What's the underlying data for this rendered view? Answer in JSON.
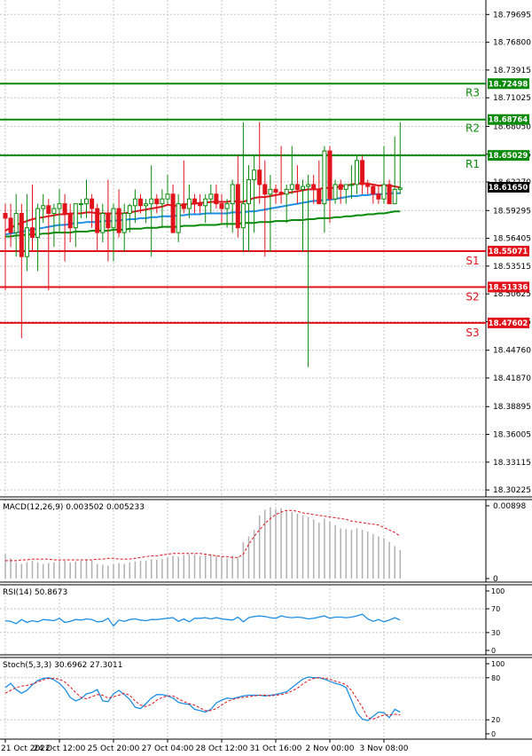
{
  "chart_data": {
    "type": "candlestick",
    "price_pane": {
      "ylim": [
        18.295,
        18.812
      ],
      "y_tick_labels": [
        "18.79695",
        "18.76800",
        "18.73915",
        "18.71025",
        "18.68050",
        "18.65155",
        "18.62270",
        "18.59295",
        "18.56405",
        "18.53515",
        "18.50625",
        "18.47735",
        "18.44760",
        "18.41870",
        "18.38895",
        "18.36005",
        "18.33115",
        "18.30225"
      ],
      "y_ticks": [
        18.79695,
        18.768,
        18.73915,
        18.71025,
        18.6805,
        18.65155,
        18.6227,
        18.59295,
        18.56405,
        18.53515,
        18.50625,
        18.47735,
        18.4476,
        18.4187,
        18.38895,
        18.36005,
        18.33115,
        18.30225
      ],
      "current_price_label": "18.61650",
      "current_price": 18.6165,
      "levels": [
        {
          "name": "R3",
          "value": 18.72498,
          "label": "18.72498",
          "color": "#0a8a0a"
        },
        {
          "name": "R2",
          "value": 18.68764,
          "label": "18.68764",
          "color": "#0a8a0a"
        },
        {
          "name": "R1",
          "value": 18.65029,
          "label": "18.65029",
          "color": "#0a8a0a"
        },
        {
          "name": "S1",
          "value": 18.55071,
          "label": "18.55071",
          "color": "#e0121b"
        },
        {
          "name": "S2",
          "value": 18.51336,
          "label": "18.51336",
          "color": "#e0121b"
        },
        {
          "name": "S3",
          "value": 18.47602,
          "label": "18.47602",
          "color": "#e0121b"
        }
      ],
      "candles": [
        [
          18.59,
          18.6,
          18.51,
          18.585
        ],
        [
          18.585,
          18.6,
          18.555,
          18.57
        ],
        [
          18.57,
          18.61,
          18.545,
          18.59
        ],
        [
          18.59,
          18.6,
          18.46,
          18.545
        ],
        [
          18.545,
          18.61,
          18.53,
          18.575
        ],
        [
          18.575,
          18.62,
          18.55,
          18.565
        ],
        [
          18.565,
          18.6,
          18.53,
          18.595
        ],
        [
          18.595,
          18.61,
          18.58,
          18.598
        ],
        [
          18.598,
          18.605,
          18.51,
          18.59
        ],
        [
          18.59,
          18.6,
          18.555,
          18.595
        ],
        [
          18.595,
          18.615,
          18.57,
          18.6
        ],
        [
          18.6,
          18.61,
          18.54,
          18.59
        ],
        [
          18.59,
          18.6,
          18.56,
          18.575
        ],
        [
          18.575,
          18.6,
          18.555,
          18.6
        ],
        [
          18.6,
          18.605,
          18.585,
          18.6
        ],
        [
          18.6,
          18.625,
          18.585,
          18.605
        ],
        [
          18.605,
          18.61,
          18.575,
          18.595
        ],
        [
          18.595,
          18.6,
          18.55,
          18.57
        ],
        [
          18.57,
          18.6,
          18.56,
          18.59
        ],
        [
          18.59,
          18.625,
          18.54,
          18.575
        ],
        [
          18.575,
          18.6,
          18.54,
          18.595
        ],
        [
          18.595,
          18.615,
          18.565,
          18.57
        ],
        [
          18.57,
          18.6,
          18.55,
          18.59
        ],
        [
          18.59,
          18.6,
          18.57,
          18.598
        ],
        [
          18.598,
          18.615,
          18.58,
          18.605
        ],
        [
          18.605,
          18.61,
          18.59,
          18.598
        ],
        [
          18.598,
          18.605,
          18.58,
          18.6
        ],
        [
          18.6,
          18.64,
          18.545,
          18.605
        ],
        [
          18.605,
          18.61,
          18.59,
          18.6
        ],
        [
          18.6,
          18.615,
          18.575,
          18.605
        ],
        [
          18.605,
          18.63,
          18.6,
          18.61
        ],
        [
          18.61,
          18.62,
          18.58,
          18.57
        ],
        [
          18.57,
          18.61,
          18.56,
          18.6
        ],
        [
          18.6,
          18.645,
          18.59,
          18.595
        ],
        [
          18.595,
          18.62,
          18.585,
          18.605
        ],
        [
          18.605,
          18.61,
          18.59,
          18.6
        ],
        [
          18.6,
          18.61,
          18.59,
          18.598
        ],
        [
          18.598,
          18.61,
          18.58,
          18.605
        ],
        [
          18.605,
          18.62,
          18.59,
          18.61
        ],
        [
          18.61,
          18.62,
          18.595,
          18.6
        ],
        [
          18.6,
          18.61,
          18.58,
          18.595
        ],
        [
          18.595,
          18.605,
          18.575,
          18.6
        ],
        [
          18.6,
          18.625,
          18.57,
          18.62
        ],
        [
          18.62,
          18.65,
          18.565,
          18.575
        ],
        [
          18.575,
          18.685,
          18.55,
          18.6
        ],
        [
          18.6,
          18.64,
          18.55,
          18.625
        ],
        [
          18.625,
          18.65,
          18.57,
          18.635
        ],
        [
          18.635,
          18.685,
          18.6,
          18.62
        ],
        [
          18.62,
          18.645,
          18.545,
          18.61
        ],
        [
          18.61,
          18.63,
          18.55,
          18.615
        ],
        [
          18.615,
          18.62,
          18.6,
          18.612
        ],
        [
          18.612,
          18.66,
          18.6,
          18.61
        ],
        [
          18.61,
          18.62,
          18.58,
          18.615
        ],
        [
          18.615,
          18.66,
          18.61,
          18.62
        ],
        [
          18.62,
          18.64,
          18.6,
          18.615
        ],
        [
          18.615,
          18.625,
          18.55,
          18.618
        ],
        [
          18.618,
          18.63,
          18.43,
          18.62
        ],
        [
          18.62,
          18.63,
          18.6,
          18.615
        ],
        [
          18.615,
          18.645,
          18.6,
          18.6
        ],
        [
          18.6,
          18.66,
          18.57,
          18.655
        ],
        [
          18.655,
          18.66,
          18.58,
          18.605
        ],
        [
          18.605,
          18.625,
          18.6,
          18.62
        ],
        [
          18.62,
          18.625,
          18.6,
          18.615
        ],
        [
          18.615,
          18.62,
          18.6,
          18.62
        ],
        [
          18.62,
          18.64,
          18.605,
          18.62
        ],
        [
          18.62,
          18.65,
          18.61,
          18.645
        ],
        [
          18.645,
          18.65,
          18.61,
          18.62
        ],
        [
          18.62,
          18.625,
          18.61,
          18.618
        ],
        [
          18.618,
          18.62,
          18.6,
          18.61
        ],
        [
          18.61,
          18.62,
          18.6,
          18.605
        ],
        [
          18.605,
          18.66,
          18.6,
          18.62
        ],
        [
          18.62,
          18.625,
          18.6,
          18.6
        ],
        [
          18.6,
          18.67,
          18.6,
          18.615
        ],
        [
          18.615,
          18.685,
          18.61,
          18.6165
        ]
      ],
      "ma_red": [
        18.572,
        18.575,
        18.578,
        18.58,
        18.582,
        18.584,
        18.585,
        18.586,
        18.587,
        18.588,
        18.589,
        18.589,
        18.59,
        18.59,
        18.59,
        18.591,
        18.591,
        18.59,
        18.59,
        18.59,
        18.59,
        18.59,
        18.59,
        18.591,
        18.592,
        18.593,
        18.594,
        18.595,
        18.596,
        18.597,
        18.599,
        18.598,
        18.598,
        18.599,
        18.6,
        18.6,
        18.601,
        18.601,
        18.602,
        18.602,
        18.602,
        18.602,
        18.603,
        18.602,
        18.602,
        18.604,
        18.606,
        18.607,
        18.607,
        18.608,
        18.609,
        18.61,
        18.611,
        18.612,
        18.613,
        18.614,
        18.615,
        18.615,
        18.615,
        18.617,
        18.616,
        18.617,
        18.618,
        18.619,
        18.62,
        18.621,
        18.621,
        18.621,
        18.62,
        18.619,
        18.619,
        18.619,
        18.618,
        18.617
      ],
      "ma_blue": [
        18.568,
        18.569,
        18.57,
        18.571,
        18.572,
        18.573,
        18.574,
        18.575,
        18.576,
        18.577,
        18.578,
        18.578,
        18.579,
        18.58,
        18.58,
        18.581,
        18.581,
        18.581,
        18.582,
        18.582,
        18.582,
        18.583,
        18.583,
        18.584,
        18.584,
        18.585,
        18.585,
        18.586,
        18.586,
        18.587,
        18.587,
        18.587,
        18.588,
        18.588,
        18.589,
        18.589,
        18.589,
        18.59,
        18.59,
        18.59,
        18.59,
        18.59,
        18.591,
        18.591,
        18.591,
        18.592,
        18.592,
        18.593,
        18.594,
        18.595,
        18.596,
        18.597,
        18.598,
        18.599,
        18.6,
        18.601,
        18.602,
        18.603,
        18.603,
        18.604,
        18.604,
        18.605,
        18.606,
        18.607,
        18.608,
        18.608,
        18.609,
        18.609,
        18.61,
        18.61,
        18.61,
        18.611,
        18.611,
        18.611
      ],
      "ma_green": [
        18.566,
        18.566,
        18.567,
        18.567,
        18.568,
        18.568,
        18.568,
        18.569,
        18.569,
        18.57,
        18.57,
        18.57,
        18.57,
        18.571,
        18.571,
        18.571,
        18.572,
        18.572,
        18.572,
        18.572,
        18.573,
        18.573,
        18.573,
        18.574,
        18.574,
        18.574,
        18.575,
        18.575,
        18.575,
        18.576,
        18.576,
        18.576,
        18.576,
        18.577,
        18.577,
        18.577,
        18.578,
        18.578,
        18.578,
        18.578,
        18.579,
        18.579,
        18.579,
        18.579,
        18.58,
        18.58,
        18.58,
        18.581,
        18.581,
        18.581,
        18.582,
        18.582,
        18.582,
        18.583,
        18.583,
        18.583,
        18.584,
        18.584,
        18.585,
        18.585,
        18.585,
        18.586,
        18.586,
        18.587,
        18.587,
        18.588,
        18.588,
        18.589,
        18.589,
        18.59,
        18.59,
        18.591,
        18.592,
        18.592
      ]
    },
    "macd_pane": {
      "title": "MACD(12,26,9) 0.003502 0.005233",
      "y_tick_labels": [
        "0.00898",
        "0"
      ],
      "ylim": [
        0,
        0.00898
      ],
      "histogram": [
        0.003,
        0.0025,
        0.002,
        0.0018,
        0.002,
        0.0022,
        0.002,
        0.0018,
        0.0019,
        0.002,
        0.0021,
        0.0022,
        0.002,
        0.0021,
        0.0022,
        0.0024,
        0.0022,
        0.0018,
        0.0017,
        0.0016,
        0.0018,
        0.0019,
        0.0018,
        0.002,
        0.0021,
        0.0022,
        0.0022,
        0.0024,
        0.0023,
        0.0024,
        0.0026,
        0.0028,
        0.0027,
        0.0029,
        0.003,
        0.003,
        0.0028,
        0.0029,
        0.003,
        0.0028,
        0.0027,
        0.0025,
        0.0028,
        0.0026,
        0.0045,
        0.0052,
        0.006,
        0.0078,
        0.0085,
        0.0088,
        0.0086,
        0.0087,
        0.0083,
        0.0082,
        0.008,
        0.0078,
        0.0076,
        0.0073,
        0.0069,
        0.0074,
        0.007,
        0.0066,
        0.0062,
        0.0061,
        0.006,
        0.0062,
        0.006,
        0.0058,
        0.0055,
        0.0052,
        0.005,
        0.0045,
        0.004,
        0.0035
      ],
      "signal": [
        0.0022,
        0.0022,
        0.0022,
        0.0023,
        0.0023,
        0.0024,
        0.0024,
        0.0024,
        0.0024,
        0.0023,
        0.0023,
        0.0023,
        0.0023,
        0.0023,
        0.0023,
        0.0023,
        0.0023,
        0.0024,
        0.0024,
        0.0025,
        0.0025,
        0.0024,
        0.0024,
        0.0024,
        0.0025,
        0.0026,
        0.0027,
        0.0028,
        0.0028,
        0.0029,
        0.003,
        0.0031,
        0.0031,
        0.0031,
        0.0031,
        0.0031,
        0.0031,
        0.003,
        0.0029,
        0.0028,
        0.0027,
        0.0027,
        0.0026,
        0.0026,
        0.003,
        0.0042,
        0.0052,
        0.006,
        0.0068,
        0.0074,
        0.0079,
        0.0082,
        0.0084,
        0.0084,
        0.0083,
        0.0081,
        0.008,
        0.0079,
        0.0078,
        0.0077,
        0.0076,
        0.0075,
        0.0074,
        0.0073,
        0.0071,
        0.007,
        0.0069,
        0.0068,
        0.0067,
        0.0066,
        0.0063,
        0.006,
        0.0057,
        0.0052
      ]
    },
    "rsi_pane": {
      "title": "RSI(14) 50.8673",
      "y_tick_labels": [
        "100",
        "70",
        "30",
        "0"
      ],
      "y_ticks": [
        100,
        70,
        30,
        0
      ],
      "ylim": [
        0,
        100
      ],
      "values": [
        50,
        49,
        45,
        52,
        47,
        50,
        48,
        52,
        51,
        50,
        54,
        47,
        49,
        52,
        51,
        53,
        52,
        48,
        49,
        54,
        41,
        51,
        49,
        52,
        53,
        51,
        50,
        52,
        52,
        53,
        54,
        55,
        49,
        53,
        48,
        54,
        54,
        55,
        53,
        55,
        53,
        52,
        51,
        56,
        48,
        55,
        57,
        58,
        57,
        55,
        54,
        58,
        56,
        55,
        56,
        55,
        53,
        54,
        56,
        58,
        54,
        56,
        56,
        55,
        56,
        58,
        61,
        53,
        49,
        52,
        48,
        51,
        55,
        51
      ]
    },
    "stoch_pane": {
      "title": "Stoch(5,3,3) 30.6962 27.3011",
      "y_tick_labels": [
        "100",
        "80",
        "20",
        "0"
      ],
      "y_ticks": [
        100,
        80,
        20,
        0
      ],
      "ylim": [
        0,
        100
      ],
      "k": [
        66,
        72,
        63,
        58,
        62,
        70,
        76,
        79,
        80,
        77,
        72,
        64,
        52,
        47,
        50,
        57,
        59,
        63,
        47,
        46,
        57,
        62,
        56,
        49,
        38,
        36,
        43,
        51,
        56,
        56,
        54,
        51,
        45,
        43,
        42,
        35,
        33,
        31,
        35,
        44,
        48,
        51,
        50,
        52,
        54,
        55,
        55,
        55,
        54,
        55,
        56,
        58,
        60,
        66,
        72,
        78,
        81,
        80,
        80,
        78,
        75,
        72,
        70,
        66,
        48,
        30,
        21,
        19,
        25,
        31,
        30,
        23,
        35,
        31
      ],
      "d": [
        58,
        62,
        66,
        68,
        69,
        71,
        74,
        77,
        79,
        79,
        78,
        74,
        67,
        59,
        52,
        50,
        53,
        56,
        55,
        51,
        53,
        55,
        58,
        55,
        47,
        41,
        39,
        42,
        48,
        52,
        54,
        54,
        50,
        46,
        43,
        41,
        37,
        33,
        33,
        36,
        41,
        46,
        49,
        51,
        52,
        53,
        54,
        55,
        55,
        54,
        55,
        56,
        58,
        61,
        65,
        71,
        76,
        79,
        80,
        79,
        78,
        75,
        73,
        70,
        62,
        50,
        38,
        23,
        21,
        24,
        27,
        27,
        28,
        27
      ]
    },
    "x_labels": [
      "21 Oct 2022",
      "24 Oct 12:00",
      "25 Oct 20:00",
      "27 Oct 04:00",
      "28 Oct 12:00",
      "31 Oct 16:00",
      "2 Nov 00:00",
      "3 Nov 08:00"
    ],
    "x_label_index": [
      0,
      10,
      20,
      30,
      40,
      50,
      60,
      70
    ]
  },
  "colors": {
    "bull": "#0a8a0a",
    "bear": "#e0121b",
    "ma_red": "#e0121b",
    "ma_blue": "#1e8fe6",
    "ma_green": "#0a8a0a",
    "rsi_line": "#1e8fe6",
    "stoch_k": "#1e8fe6",
    "stoch_d": "#e0121b",
    "grid": "#c4c4c4",
    "current_price_bg": "#000000"
  }
}
